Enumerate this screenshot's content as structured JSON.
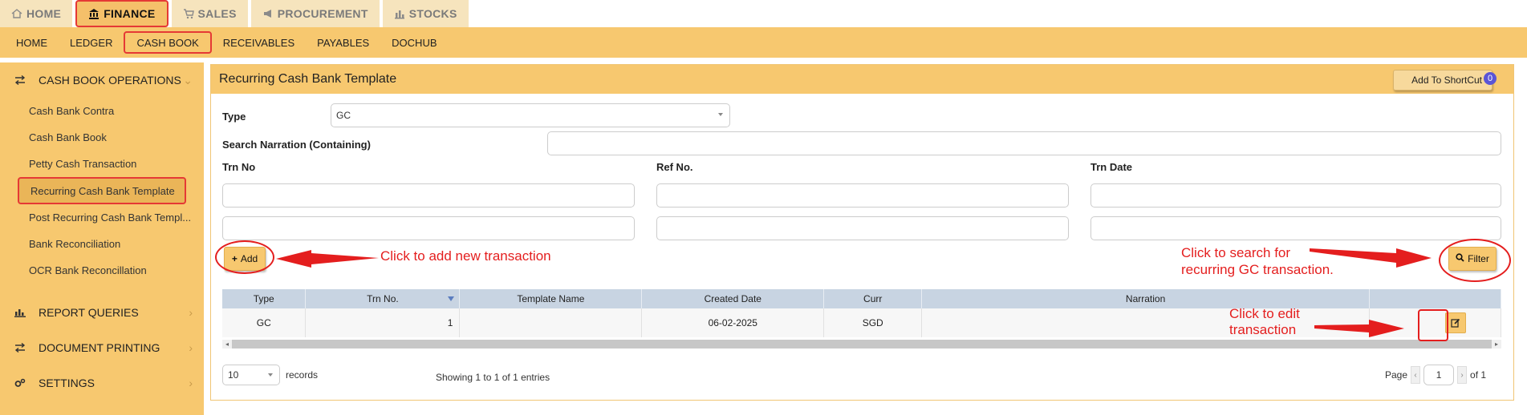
{
  "top_tabs": [
    {
      "label": "HOME",
      "icon": "home-icon"
    },
    {
      "label": "FINANCE",
      "icon": "bank-icon"
    },
    {
      "label": "SALES",
      "icon": "cart-icon"
    },
    {
      "label": "PROCUREMENT",
      "icon": "megaphone-icon"
    },
    {
      "label": "STOCKS",
      "icon": "bar-chart-icon"
    }
  ],
  "sub_nav": [
    "HOME",
    "LEDGER",
    "CASH BOOK",
    "RECEIVABLES",
    "PAYABLES",
    "DOCHUB"
  ],
  "sidebar": {
    "group_operations": "CASH BOOK OPERATIONS",
    "items": [
      "Cash Bank Contra",
      "Cash Bank Book",
      "Petty Cash Transaction",
      "Recurring Cash Bank Template",
      "Post Recurring Cash Bank Templ...",
      "Bank Reconciliation",
      "OCR Bank Reconcillation"
    ],
    "group_reports": "REPORT QUERIES",
    "group_printing": "DOCUMENT PRINTING",
    "group_settings": "SETTINGS"
  },
  "panel": {
    "title": "Recurring Cash Bank Template",
    "shortcut_label": "Add To ShortCut",
    "shortcut_count": "0"
  },
  "form": {
    "type_label": "Type",
    "type_value": "GC",
    "narration_label": "Search Narration (Containing)",
    "trn_no_label": "Trn No",
    "ref_no_label": "Ref No.",
    "trn_date_label": "Trn Date"
  },
  "buttons": {
    "add": "Add",
    "filter": "Filter"
  },
  "table": {
    "columns": [
      "Type",
      "Trn No.",
      "Template Name",
      "Created Date",
      "Curr",
      "Narration",
      ""
    ],
    "rows": [
      {
        "type": "GC",
        "trn_no": "1",
        "template_name": "",
        "created_date": "06-02-2025",
        "curr": "SGD",
        "narration": ""
      }
    ]
  },
  "footer": {
    "page_size": "10",
    "records_label": "records",
    "showing": "Showing 1 to 1 of 1 entries",
    "page_label": "Page",
    "page_value": "1",
    "of_label": "of 1"
  },
  "annotations": {
    "add_note": "Click to add new transaction",
    "filter_note_1": "Click to search for",
    "filter_note_2": "recurring GC transaction.",
    "edit_note_1": "Click to edit",
    "edit_note_2": "transaction"
  },
  "colors": {
    "accent": "#f7c86f",
    "highlight": "#e53935",
    "table_header": "#c8d4e2"
  }
}
